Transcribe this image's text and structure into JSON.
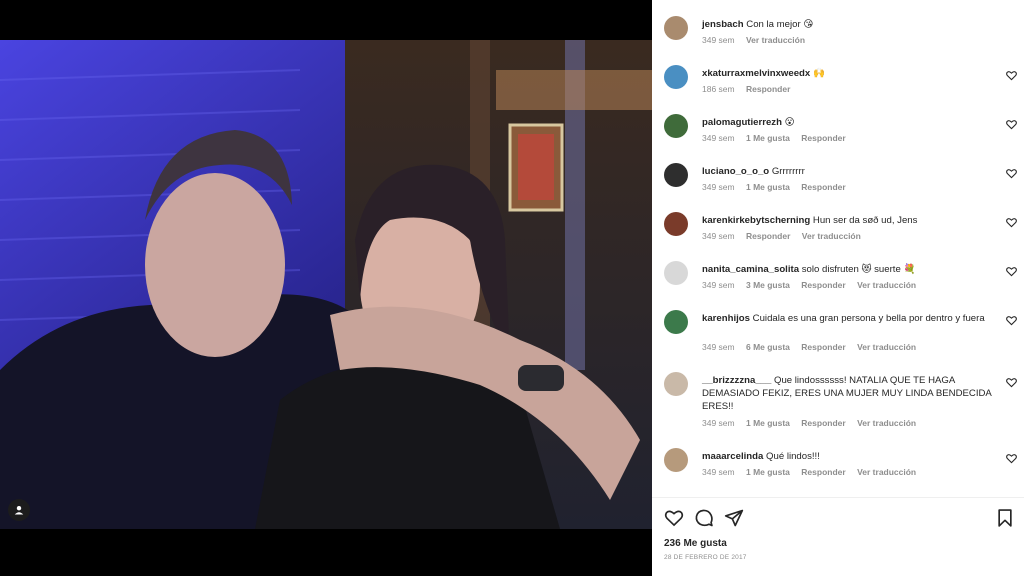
{
  "comments": [
    {
      "username": "jensbach",
      "text": "Con la mejor 😘",
      "time": "349 sem",
      "likes": "",
      "reply": "",
      "translate": "Ver traducción",
      "avatar_color": "#a98b6e",
      "has_heart": false
    },
    {
      "username": "xkaturraxmelvinxweedx",
      "text": "🙌",
      "time": "186 sem",
      "likes": "",
      "reply": "Responder",
      "translate": "",
      "avatar_color": "#4a8fc2",
      "has_heart": true
    },
    {
      "username": "palomagutierrezh",
      "text": "😮",
      "time": "349 sem",
      "likes": "1 Me gusta",
      "reply": "Responder",
      "translate": "",
      "avatar_color": "#3f6b3a",
      "has_heart": true
    },
    {
      "username": "luciano_o_o_o",
      "text": "Grrrrrrrr",
      "time": "349 sem",
      "likes": "1 Me gusta",
      "reply": "Responder",
      "translate": "",
      "avatar_color": "#2e2e2e",
      "has_heart": true
    },
    {
      "username": "karenkirkebytscherning",
      "text": "Hun ser da søð ud, Jens",
      "time": "349 sem",
      "likes": "",
      "reply": "Responder",
      "translate": "Ver traducción",
      "avatar_color": "#7a3b2a",
      "has_heart": true
    },
    {
      "username": "nanita_camina_solita",
      "text": "solo disfruten 😻 suerte 💐",
      "time": "349 sem",
      "likes": "3 Me gusta",
      "reply": "Responder",
      "translate": "Ver traducción",
      "avatar_color": "#d8d8d8",
      "has_heart": true
    },
    {
      "username": "karenhijos",
      "text": "Cuidala es una gran persona y bella por dentro y fuera",
      "time": "349 sem",
      "likes": "6 Me gusta",
      "reply": "Responder",
      "translate": "Ver traducción",
      "avatar_color": "#3c7a4b",
      "has_heart": true
    },
    {
      "username": "__brizzzzna___",
      "text": "Que lindossssss! NATALIA QUE TE HAGA DEMASIADO FEKIZ, ERES UNA MUJER MUY LINDA BENDECIDA ERES!!",
      "time": "349 sem",
      "likes": "1 Me gusta",
      "reply": "Responder",
      "translate": "Ver traducción",
      "avatar_color": "#c9b9a8",
      "has_heart": true
    },
    {
      "username": "maaarcelinda",
      "text": "Qué lindos!!!",
      "time": "349 sem",
      "likes": "1 Me gusta",
      "reply": "Responder",
      "translate": "Ver traducción",
      "avatar_color": "#b69a7c",
      "has_heart": true
    }
  ],
  "footer": {
    "likes": "236 Me gusta",
    "date": "28 DE FEBRERO DE 2017"
  },
  "icons": {
    "like": "heart-icon",
    "comment": "comment-icon",
    "share": "send-icon",
    "save": "bookmark-icon",
    "tag": "user-tag-icon"
  }
}
